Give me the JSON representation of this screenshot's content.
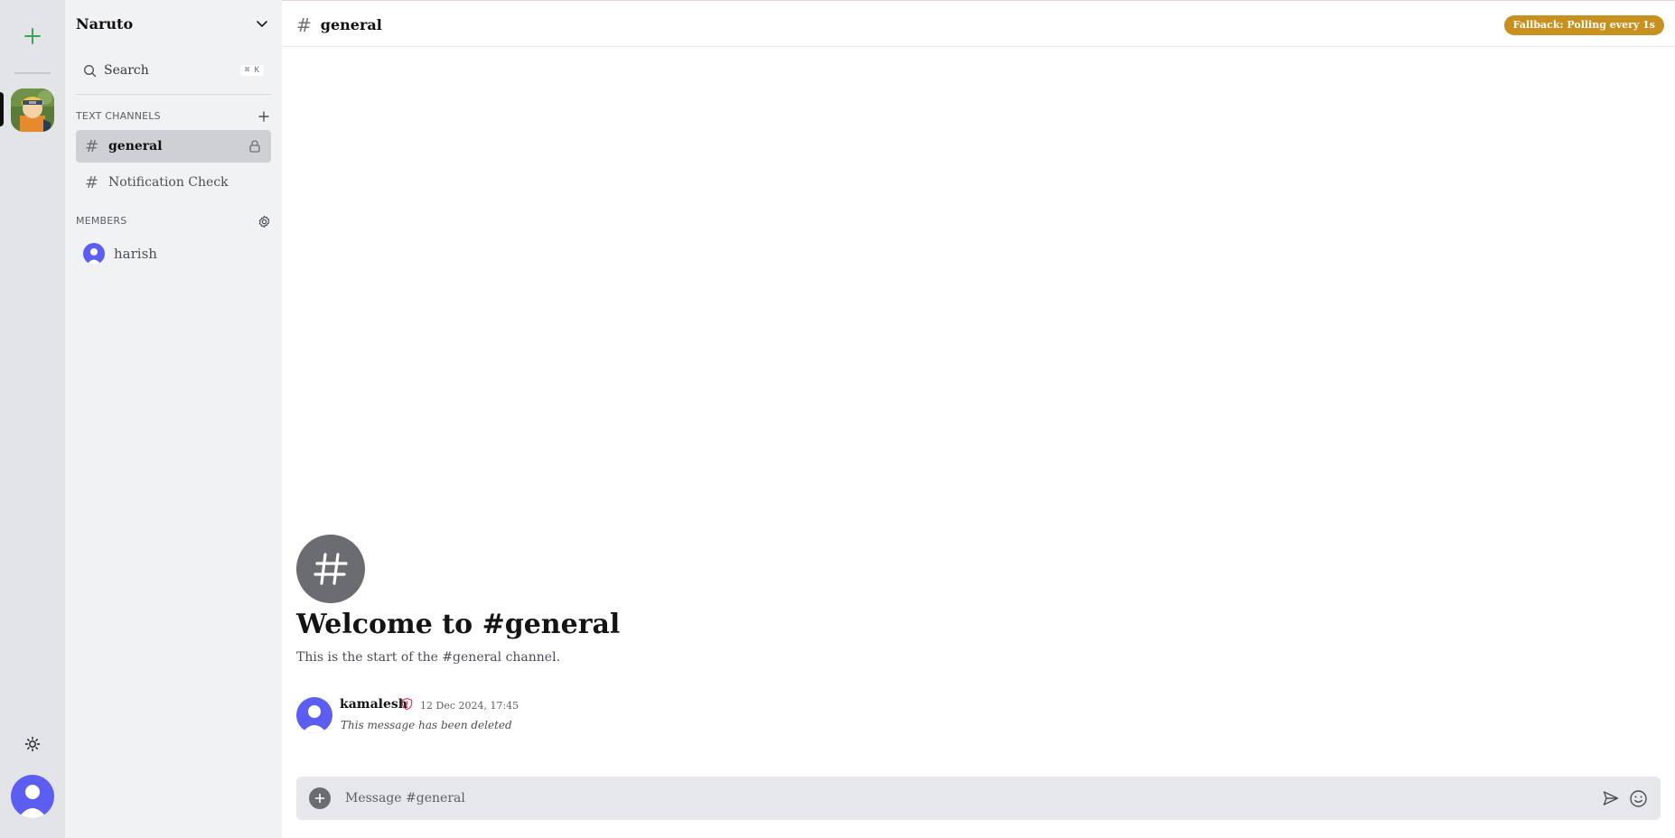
{
  "server": {
    "name": "Naruto",
    "search_label": "Search",
    "search_shortcut": "⌘ K"
  },
  "sidebar": {
    "text_channels_label": "TEXT CHANNELS",
    "channels": [
      {
        "name": "general",
        "active": true,
        "locked": true
      },
      {
        "name": "Notification Check",
        "active": false,
        "locked": false
      }
    ],
    "members_label": "MEMBERS",
    "members": [
      {
        "name": "harish"
      }
    ]
  },
  "header": {
    "channel_name": "general",
    "status_badge": "Fallback: Polling every 1s"
  },
  "welcome": {
    "title": "Welcome to #general",
    "subtitle": "This is the start of the #general channel."
  },
  "messages": [
    {
      "author": "kamalesh",
      "timestamp": "12 Dec 2024, 17:45",
      "content": "This message has been deleted"
    }
  ],
  "composer": {
    "placeholder": "Message #general"
  },
  "colors": {
    "accent_green": "#3ba55d",
    "badge": "#c8901e",
    "avatar_purple": "#5b5ef0",
    "role_red": "#e63d58"
  },
  "icons": {
    "add_server": "plus-icon",
    "theme": "sun-icon",
    "header_dropdown": "chevron-down-icon",
    "search": "search-icon",
    "add_channel": "plus-icon",
    "member_settings": "gear-icon",
    "lock": "lock-icon",
    "moderator": "shield-alert-icon",
    "send": "send-icon",
    "emoji": "smile-icon"
  }
}
